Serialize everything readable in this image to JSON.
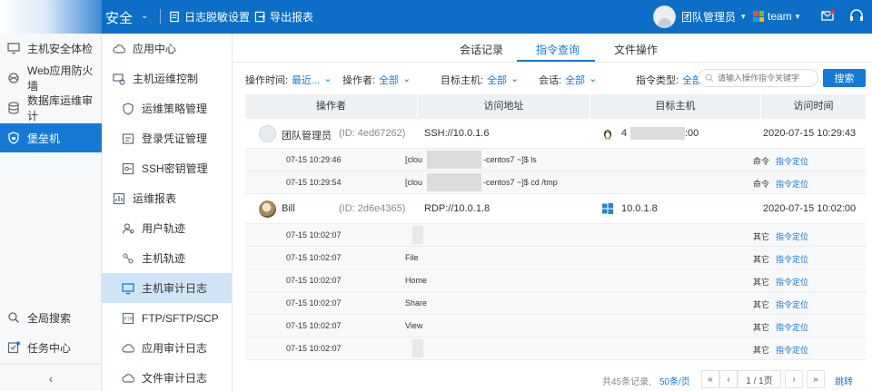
{
  "header": {
    "title": "安全",
    "export_audit_label": "日志脱敏设置",
    "export_report_label": "导出报表",
    "user_name": "团队管理员",
    "team_name": "team"
  },
  "sidebar": {
    "items": [
      {
        "label": "主机安全体检",
        "icon": "host-check-icon"
      },
      {
        "label": "Web应用防火墙",
        "icon": "waf-icon"
      },
      {
        "label": "数据库运维审计",
        "icon": "database-icon"
      },
      {
        "label": "堡垒机",
        "icon": "shield-icon"
      }
    ],
    "bottom_items": [
      {
        "label": "全局搜索",
        "icon": "search-icon"
      },
      {
        "label": "任务中心",
        "icon": "task-icon"
      }
    ],
    "collapse_glyph": "‹"
  },
  "subnav": {
    "items": [
      {
        "label": "应用中心",
        "kind": "group"
      },
      {
        "label": "主机运维控制",
        "kind": "group"
      },
      {
        "label": "运维策略管理",
        "kind": "child"
      },
      {
        "label": "登录凭证管理",
        "kind": "child"
      },
      {
        "label": "SSH密钥管理",
        "kind": "child"
      },
      {
        "label": "运维报表",
        "kind": "group"
      },
      {
        "label": "用户轨迹",
        "kind": "child"
      },
      {
        "label": "主机轨迹",
        "kind": "child"
      },
      {
        "label": "主机审计日志",
        "kind": "child",
        "active": true
      },
      {
        "label": "FTP/SFTP/SCP",
        "kind": "child"
      },
      {
        "label": "应用审计日志",
        "kind": "child"
      },
      {
        "label": "文件审计日志",
        "kind": "child"
      }
    ]
  },
  "tabs": [
    "会话记录",
    "指令查询",
    "文件操作"
  ],
  "filters": {
    "time_label": "操作时间:",
    "time_value": "最近...",
    "operator_label": "操作者:",
    "operator_value": "全部",
    "target_label": "目标主机:",
    "target_value": "全部",
    "session_label": "会话:",
    "session_value": "全部",
    "cmd_type_label": "指令类型:",
    "cmd_type_value": "全部",
    "search_placeholder": "请输入操作指令关键字",
    "search_button": "搜索"
  },
  "table": {
    "headers": [
      "操作者",
      "访问地址",
      "目标主机",
      "访问时间"
    ],
    "sessions": [
      {
        "user": "团队管理员",
        "id": "(ID: 4ed67262)",
        "address": "SSH://10.0.1.6",
        "host_prefix": "4",
        "host_suffix": ":00",
        "os": "linux",
        "time": "2020-07-15   10:29:43",
        "commands": [
          {
            "time": "07-15 10:29:46",
            "pre": "[clou",
            "post": "-centos7 ~]$ ls",
            "type": "命令",
            "link": "指令定位"
          },
          {
            "time": "07-15 10:29:54",
            "pre": "[clou",
            "post": "-centos7 ~]$ cd /tmp",
            "type": "命令",
            "link": "指令定位"
          }
        ]
      },
      {
        "user": "Bill",
        "id": "(ID: 2d6e4365)",
        "address": "RDP://10.0.1.8",
        "host": "10.0.1.8",
        "os": "windows",
        "time": "2020-07-15   10:02:00",
        "commands": [
          {
            "time": "07-15 10:02:07",
            "text": "",
            "type": "其它",
            "link": "指令定位"
          },
          {
            "time": "07-15 10:02:07",
            "text": "File",
            "type": "其它",
            "link": "指令定位"
          },
          {
            "time": "07-15 10:02:07",
            "text": "Home",
            "type": "其它",
            "link": "指令定位"
          },
          {
            "time": "07-15 10:02:07",
            "text": "Share",
            "type": "其它",
            "link": "指令定位"
          },
          {
            "time": "07-15 10:02:07",
            "text": "View",
            "type": "其它",
            "link": "指令定位"
          },
          {
            "time": "07-15 10:02:07",
            "text": "",
            "type": "其它",
            "link": "指令定位"
          }
        ]
      }
    ]
  },
  "pager": {
    "total": "共45条记录,",
    "page_size": "50条/页",
    "first": "«",
    "prev": "‹",
    "page": "1 / 1页",
    "next": "›",
    "last": "»",
    "jump": "跳转"
  },
  "colors": {
    "primary": "#1679d4",
    "topbar": "#0d6ec8",
    "active_sub": "#cfe5f7"
  }
}
